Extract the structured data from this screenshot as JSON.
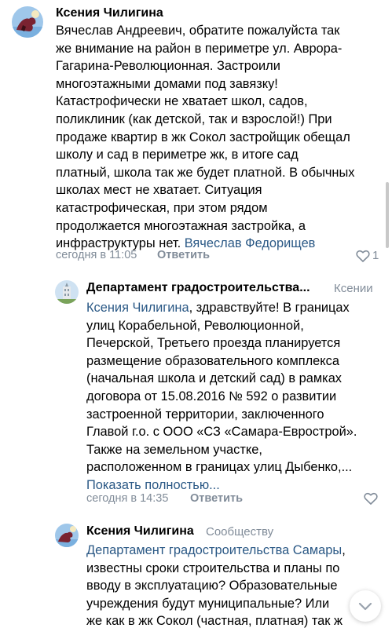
{
  "comments": [
    {
      "author": "Ксения Чилигина",
      "recipient": "",
      "lines": [
        "Вячеслав Андреевич, обратите пожалуйста так",
        "же внимание на район в периметре ул. Аврора-",
        "Гагарина-Революционная. Застроили",
        "многоэтажными домами под завязку!",
        "Катастрофически не хватает школ, садов,",
        "поликлиник (как детской, так и взрослой!) При",
        "продаже квартир в жк Сокол застройщик обещал",
        "школу и сад в периметре жк, в итоге сад",
        "платный, школа так же будет платной. В обычных",
        "школах мест не хватает. Ситуация",
        "катастрофическая,  при этом рядом",
        "продолжается многоэтажная застройка, а"
      ],
      "last_line_text": "инфраструктуры нет. ",
      "last_line_mention": "Вячеслав Федорищев",
      "time": "сегодня в 11:05",
      "reply_label": "Ответить",
      "likes": "1"
    },
    {
      "author": "Департамент градостроительства...",
      "recipient": "Ксении",
      "first_line_mention": "Ксения Чилигина",
      "first_line_text": ", здравствуйте! В границах",
      "lines": [
        "улиц Корабельной, Революционной,",
        "Печерской, Третьего проезда планируется",
        "размещение образовательного комплекса",
        "(начальная школа и детский сад) в рамках",
        "договора от 15.08.2016 № 592 о развитии",
        "застроенной территории, заключенного",
        "Главой г.о. с ООО «СЗ «Самара-Еврострой».",
        "Также на земельном участке,",
        "расположенном в границах улиц Дыбенко,..."
      ],
      "show_more": "Показать полностью...",
      "time": "сегодня в 14:35",
      "reply_label": "Ответить",
      "likes": ""
    },
    {
      "author": "Ксения Чилигина",
      "recipient": "Сообществу",
      "first_line_mention": "Департамент градостроительства Самары",
      "first_line_text": ",",
      "lines": [
        "известны сроки строительства и планы по",
        "вводу в эксплуатацию? Образовательные",
        "учреждения будут муниципальные? Или",
        "же как в жк Сокол (частная, платная) так ж"
      ]
    }
  ],
  "icons": {
    "like": "heart-icon",
    "scroll_down": "chevron-down-icon"
  }
}
